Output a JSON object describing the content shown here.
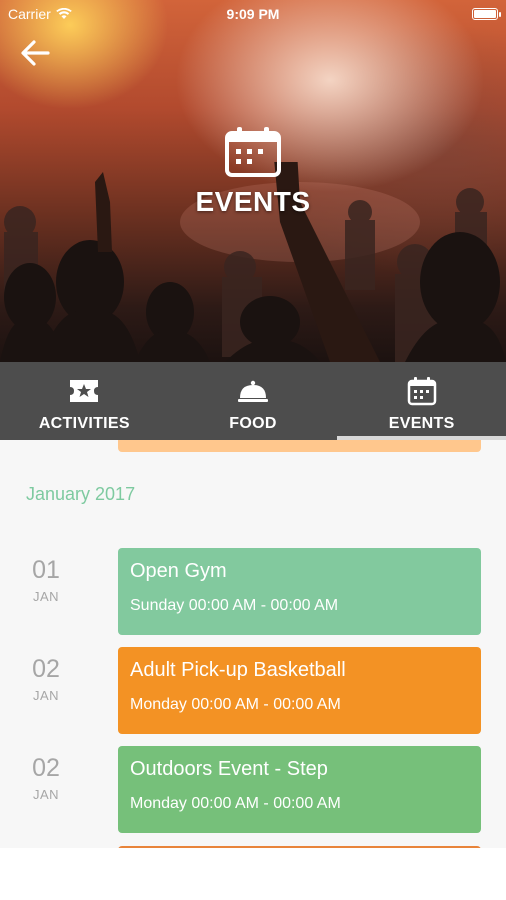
{
  "status_bar": {
    "carrier": "Carrier",
    "time": "9:09 PM"
  },
  "hero": {
    "title": "EVENTS"
  },
  "tabs": [
    {
      "label": "ACTIVITIES",
      "icon": "ticket-star-icon",
      "active": false
    },
    {
      "label": "FOOD",
      "icon": "food-cloche-icon",
      "active": false
    },
    {
      "label": "EVENTS",
      "icon": "calendar-icon",
      "active": true
    }
  ],
  "month": "January 2017",
  "events": [
    {
      "day": "01",
      "month": "JAN",
      "title": "Open Gym",
      "time": "Sunday 00:00 AM - 00:00 AM",
      "color": "#82c99e"
    },
    {
      "day": "02",
      "month": "JAN",
      "title": "Adult Pick-up Basketball",
      "time": "Monday 00:00 AM - 00:00 AM",
      "color": "#f39224"
    },
    {
      "day": "02",
      "month": "JAN",
      "title": "Outdoors Event - Step",
      "time": "Monday 00:00 AM - 00:00 AM",
      "color": "#76c07a"
    }
  ],
  "colors": {
    "tab_bar": "#4d4d4d",
    "month_label": "#7ecaa0",
    "previous_card": "#ffc78d",
    "next_card": "#e8843a"
  }
}
